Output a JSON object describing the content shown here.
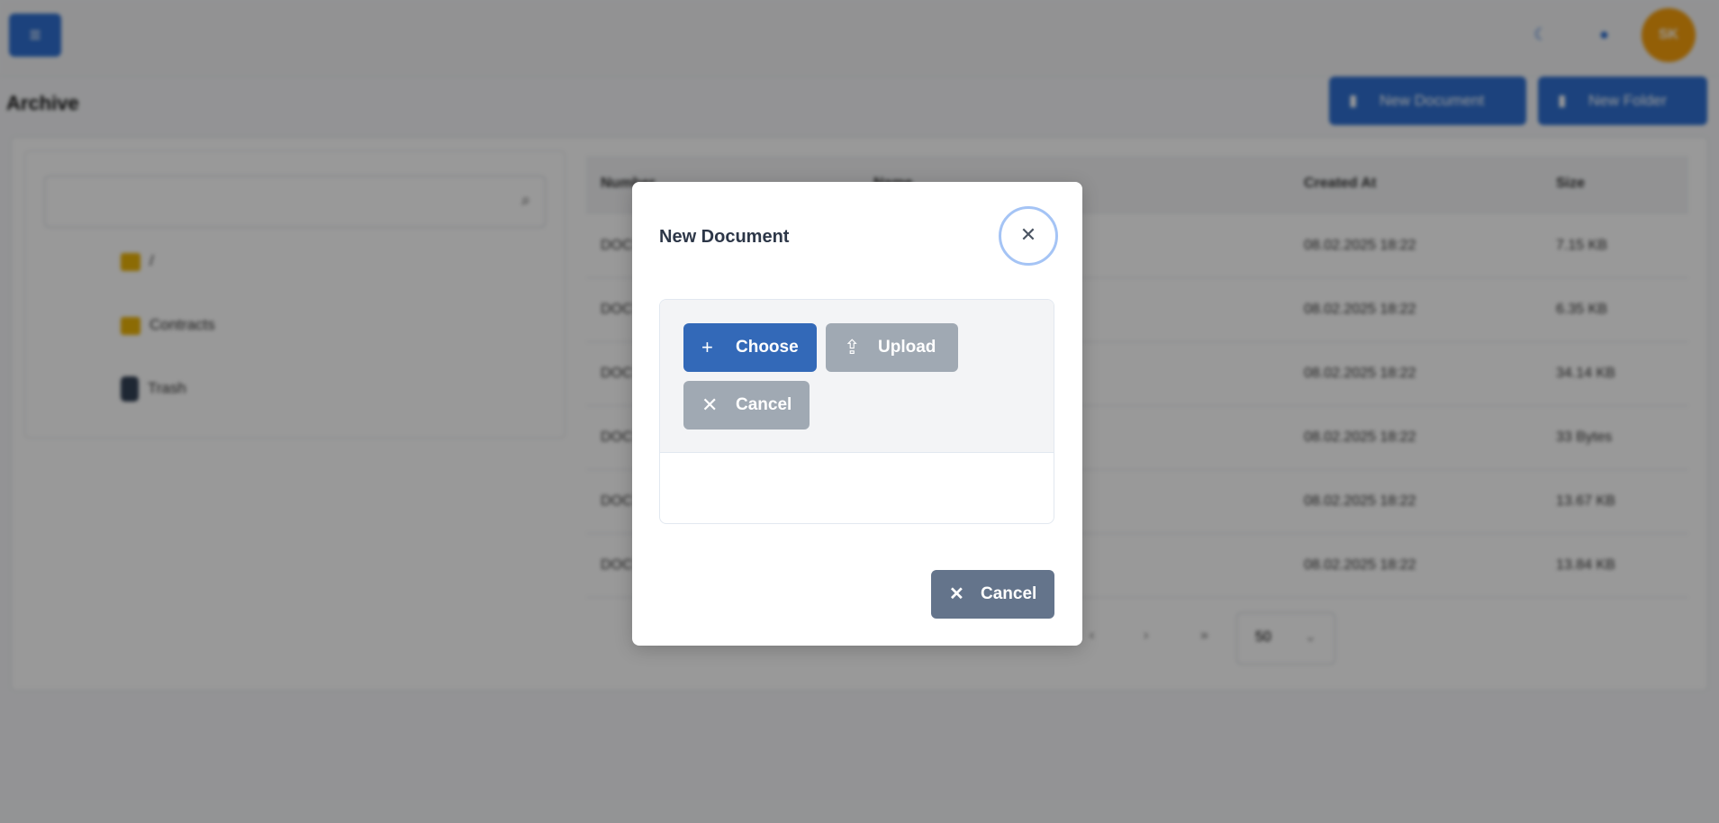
{
  "topbar": {
    "menu_icon": "bars-icon",
    "icons": [
      "moon-icon",
      "bell-icon"
    ],
    "avatar_initials": "SK"
  },
  "page": {
    "title": "Archive",
    "new_document": "New Document",
    "new_folder": "New Folder"
  },
  "tree": {
    "items": [
      {
        "label": "/",
        "icon": "folder-icon"
      },
      {
        "label": "Contracts",
        "icon": "folder-icon"
      },
      {
        "label": "Trash",
        "icon": "trash-icon"
      }
    ]
  },
  "table": {
    "columns": [
      "Number",
      "Name",
      "Created At",
      "Size"
    ],
    "rows": [
      {
        "number": "DOC",
        "name": "",
        "created": "08.02.2025 18:22",
        "size": "7.15 KB"
      },
      {
        "number": "DOC",
        "name": "",
        "created": "08.02.2025 18:22",
        "size": "6.35 KB"
      },
      {
        "number": "DOC",
        "name": "",
        "created": "08.02.2025 18:22",
        "size": "34.14 KB"
      },
      {
        "number": "DOC",
        "name": "",
        "created": "08.02.2025 18:22",
        "size": "33 Bytes"
      },
      {
        "number": "DOC",
        "name": "",
        "created": "08.02.2025 18:22",
        "size": "13.67 KB"
      },
      {
        "number": "DOC",
        "name": "",
        "created": "08.02.2025 18:22",
        "size": "13.84 KB"
      }
    ],
    "page_size": "50"
  },
  "modal": {
    "title": "New Document",
    "choose": "Choose",
    "upload": "Upload",
    "cancel_upload": "Cancel",
    "cancel": "Cancel"
  },
  "colors": {
    "primary": "#2f6fd0",
    "choose": "#3369b8",
    "disabled": "#a0a9b3",
    "secondary": "#64748b",
    "avatar": "#f59e0b"
  }
}
